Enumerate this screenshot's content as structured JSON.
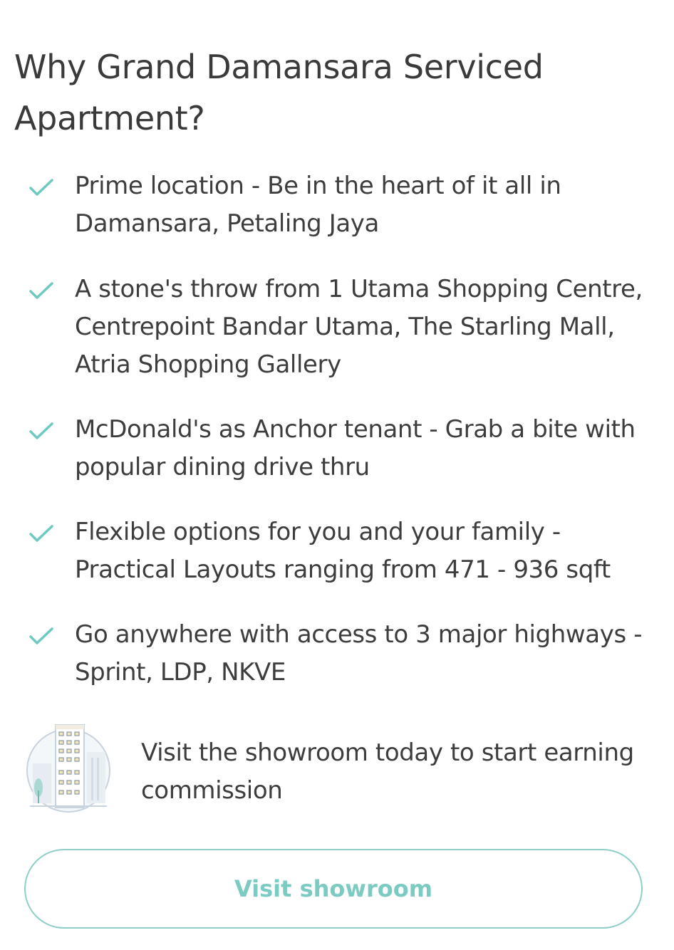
{
  "title": "Why Grand Damansara Serviced Apartment?",
  "accent_color": "#6ecac0",
  "benefits": [
    {
      "icon": "check-icon",
      "text": "Prime location - Be in the heart of it all in Damansara, Petaling Jaya"
    },
    {
      "icon": "check-icon",
      "text": "A stone's throw from  1 Utama Shopping Centre, Centrepoint Bandar Utama, The Starling Mall, Atria Shopping Gallery"
    },
    {
      "icon": "check-icon",
      "text": "McDonald's as Anchor tenant - Grab a bite with popular dining drive thru"
    },
    {
      "icon": "check-icon",
      "text": "Flexible options for you and your family - Practical Layouts ranging from 471 - 936 sqft"
    },
    {
      "icon": "check-icon",
      "text": "Go anywhere with access to 3 major highways - Sprint, LDP, NKVE"
    }
  ],
  "promo": {
    "icon": "building-illustration-icon",
    "text": "Visit the showroom today to start earning commission"
  },
  "cta": {
    "label": "Visit showroom"
  }
}
